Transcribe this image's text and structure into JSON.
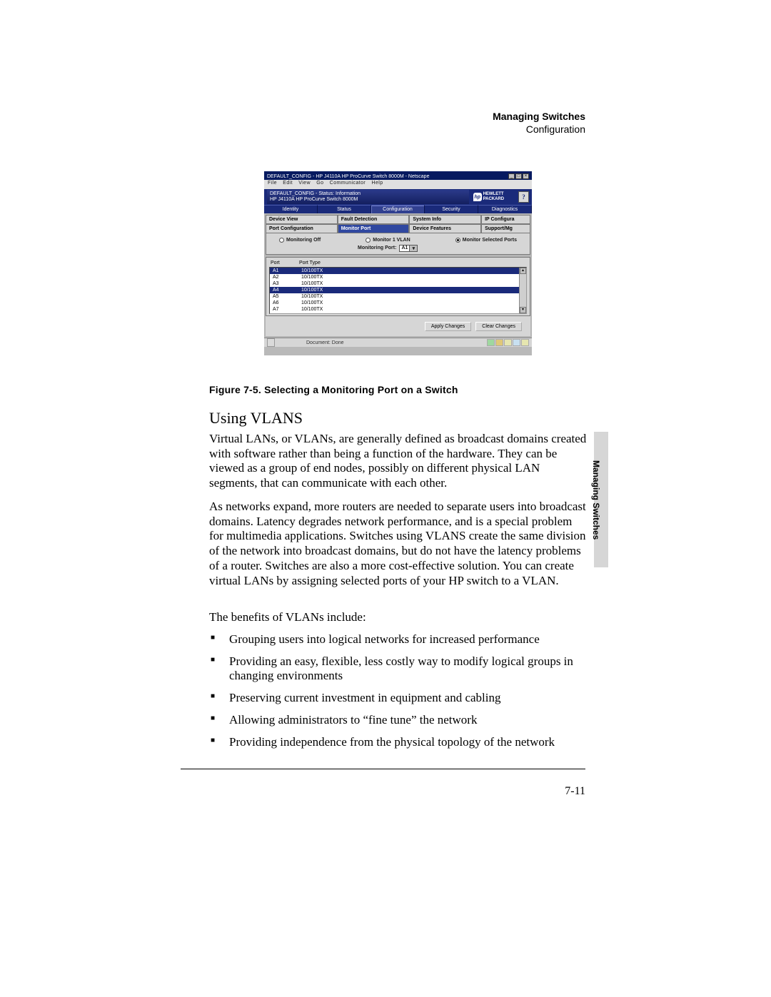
{
  "header": {
    "chapter": "Managing Switches",
    "section": "Configuration"
  },
  "figure": {
    "window_title": "DEFAULT_CONFIG - HP J4110A HP ProCurve Switch 8000M - Netscape",
    "menu": [
      "File",
      "Edit",
      "View",
      "Go",
      "Communicator",
      "Help"
    ],
    "banner_line1": "DEFAULT_CONFIG - Status: Information",
    "banner_line2": "HP J4110A HP ProCurve Switch 8000M",
    "brand": "HEWLETT PACKARD",
    "tabs1": [
      "Identity",
      "Status",
      "Configuration",
      "Security",
      "Diagnostics"
    ],
    "tabs2": [
      "Device View",
      "Fault Detection",
      "System Info",
      "IP Configura",
      "Port Configuration",
      "Monitor Port",
      "Device Features",
      "Support/Mg"
    ],
    "options": [
      "Monitoring Off",
      "Monitor 1 VLAN",
      "Monitor Selected Ports"
    ],
    "monitoring_port_label": "Monitoring Port:",
    "monitoring_port_value": "A1",
    "columns": [
      "Port",
      "Port Type"
    ],
    "rows": [
      {
        "port": "A1",
        "type": "10/100TX"
      },
      {
        "port": "A2",
        "type": "10/100TX"
      },
      {
        "port": "A3",
        "type": "10/100TX"
      },
      {
        "port": "A4",
        "type": "10/100TX"
      },
      {
        "port": "A5",
        "type": "10/100TX"
      },
      {
        "port": "A6",
        "type": "10/100TX"
      },
      {
        "port": "A7",
        "type": "10/100TX"
      }
    ],
    "buttons": [
      "Apply Changes",
      "Clear Changes"
    ],
    "status": "Document: Done",
    "caption": "Figure 7-5.   Selecting a Monitoring Port on a Switch"
  },
  "body": {
    "heading": "Using VLANS",
    "p1": "Virtual LANs, or VLANs, are generally defined as broadcast domains created with software rather than being a function of the hardware. They can be viewed as a group of end nodes, possibly on different physical LAN segments, that can communicate with each other.",
    "p2": "As networks expand, more routers are needed to separate users into broadcast domains. Latency degrades network performance, and is a special problem for multimedia applications. Switches using VLANS create the same division of the network into broadcast domains, but do not have the latency problems of a router. Switches are also a more cost-effective solution. You can create virtual LANs by assigning selected ports of your HP switch to a VLAN.",
    "p3": "The benefits of VLANs include:",
    "bullets": [
      "Grouping users into logical networks for increased performance",
      "Providing an easy, flexible, less costly way to modify logical groups in changing environments",
      "Preserving current investment in equipment and cabling",
      "Allowing administrators to “fine tune” the network",
      "Providing independence from the physical topology of the network"
    ]
  },
  "footer": {
    "page": "7-11"
  }
}
